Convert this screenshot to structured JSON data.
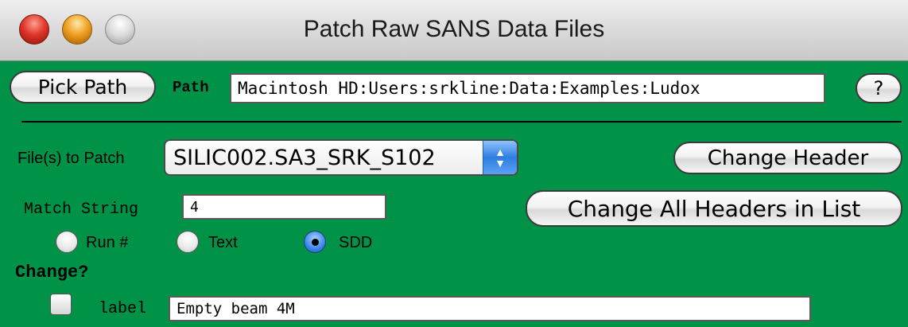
{
  "window": {
    "title": "Patch Raw SANS Data Files"
  },
  "path_row": {
    "pick_path_label": "Pick Path",
    "path_label": "Path",
    "path_value": "Macintosh HD:Users:srkline:Data:Examples:Ludox",
    "help_label": "?"
  },
  "files": {
    "label": "File(s) to Patch",
    "selected": "SILIC002.SA3_SRK_S102"
  },
  "buttons": {
    "change_header": "Change Header",
    "change_all": "Change All Headers in List"
  },
  "match": {
    "label": "Match String",
    "value": "4"
  },
  "radios": {
    "run": "Run #",
    "text": "Text",
    "sdd": "SDD",
    "selected": "SDD"
  },
  "change": {
    "heading": "Change?",
    "label_caption": "label",
    "label_value": "Empty beam 4M",
    "checked": false
  }
}
